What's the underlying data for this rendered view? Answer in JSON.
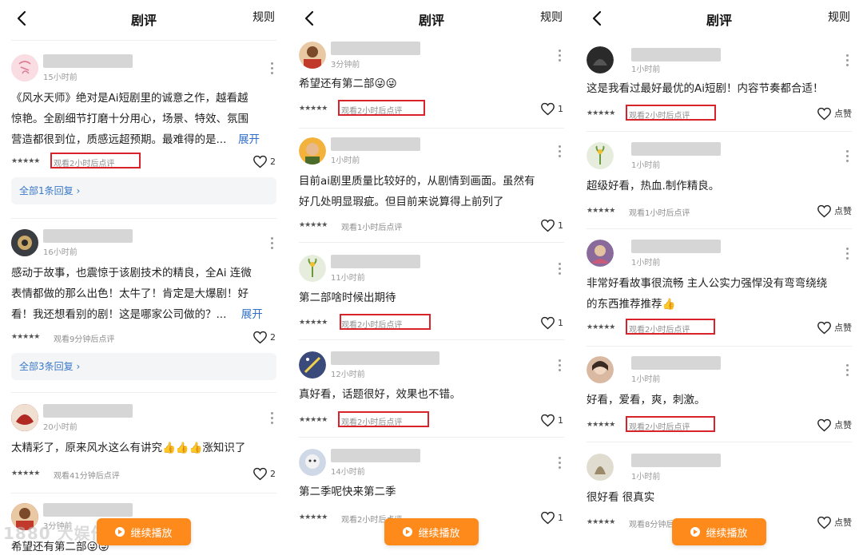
{
  "header": {
    "title": "剧评",
    "rules_label": "规则"
  },
  "stars": "★★★★★",
  "expand_label": "展开",
  "play_button_label": "继续播放",
  "watermark": "1880 大娱倍镜",
  "panel1": {
    "c1": {
      "time": "15小时前",
      "text_l1": "《风水天师》绝对是Ai短剧里的诚意之作，越看越",
      "text_l2": "惊艳。全剧细节打磨十分用心，场景、特效、氛围",
      "text_l3": "营造都很到位，质感远超预期。最难得的是...",
      "note": "观看2小时后点评",
      "likes": "2",
      "reply": "全部1条回复 ›"
    },
    "c2": {
      "time": "16小时前",
      "text_l1": "感动于故事，也震惊于该剧技术的精良，全Ai 连微",
      "text_l2": "表情都做的那么出色！太牛了！肯定是大爆剧！好",
      "text_l3": "看！我还想看别的剧！这是哪家公司做的？...",
      "note": "观看9分钟后点评",
      "likes": "2",
      "reply": "全部3条回复 ›"
    },
    "c3": {
      "time": "20小时前",
      "text_l1": "太精彩了，原来风水这么有讲究👍👍👍涨知识了",
      "note": "观看41分钟后点评",
      "likes": "2"
    },
    "c4": {
      "time": "3分钟前",
      "text_l1": "希望还有第二部😜😜"
    }
  },
  "panel2": {
    "c1": {
      "time": "3分钟前",
      "text_l1": "希望还有第二部😜😜",
      "note": "观看2小时后点评",
      "likes": "1"
    },
    "c2": {
      "time": "1小时前",
      "text_l1": "目前ai剧里质量比较好的，从剧情到画面。虽然有",
      "text_l2": "好几处明显瑕疵。但目前来说算得上前列了",
      "note": "观看1小时后点评",
      "likes": "1"
    },
    "c3": {
      "time": "11小时前",
      "text_l1": "第二部啥时候出期待",
      "note": "观看2小时后点评",
      "likes": "1"
    },
    "c4": {
      "time": "12小时前",
      "text_l1": "真好看，话题很好，效果也不错。",
      "note": "观看2小时后点评",
      "likes": "1"
    },
    "c5": {
      "time": "14小时前",
      "text_l1": "第二季呢快来第二季",
      "note": "观看2小时后点评",
      "likes": "1"
    }
  },
  "panel3": {
    "c1": {
      "time": "1小时前",
      "text_l1": "这是我看过最好最优的Ai短剧！内容节奏都合适！",
      "note": "观看2小时后点评",
      "likes": "点赞"
    },
    "c2": {
      "time": "1小时前",
      "text_l1": "超级好看，热血.制作精良。",
      "note": "观看1小时后点评",
      "likes": "点赞"
    },
    "c3": {
      "time": "1小时前",
      "text_l1": "非常好看故事很流畅 主人公实力强悍没有弯弯绕绕",
      "text_l2": "的东西推荐推荐👍",
      "note": "观看2小时后点评",
      "likes": "点赞"
    },
    "c4": {
      "time": "1小时前",
      "text_l1": "好看，爱看，爽，刺激。",
      "note": "观看2小时后点评",
      "likes": "点赞"
    },
    "c5": {
      "time": "1小时前",
      "text_l1": "很好看 很真实",
      "note": "观看8分钟后点评",
      "likes": "点赞"
    }
  },
  "colors": {
    "accent": "#ff8a1c",
    "highlight_box": "#d8232a",
    "link": "#2f6fc9"
  }
}
